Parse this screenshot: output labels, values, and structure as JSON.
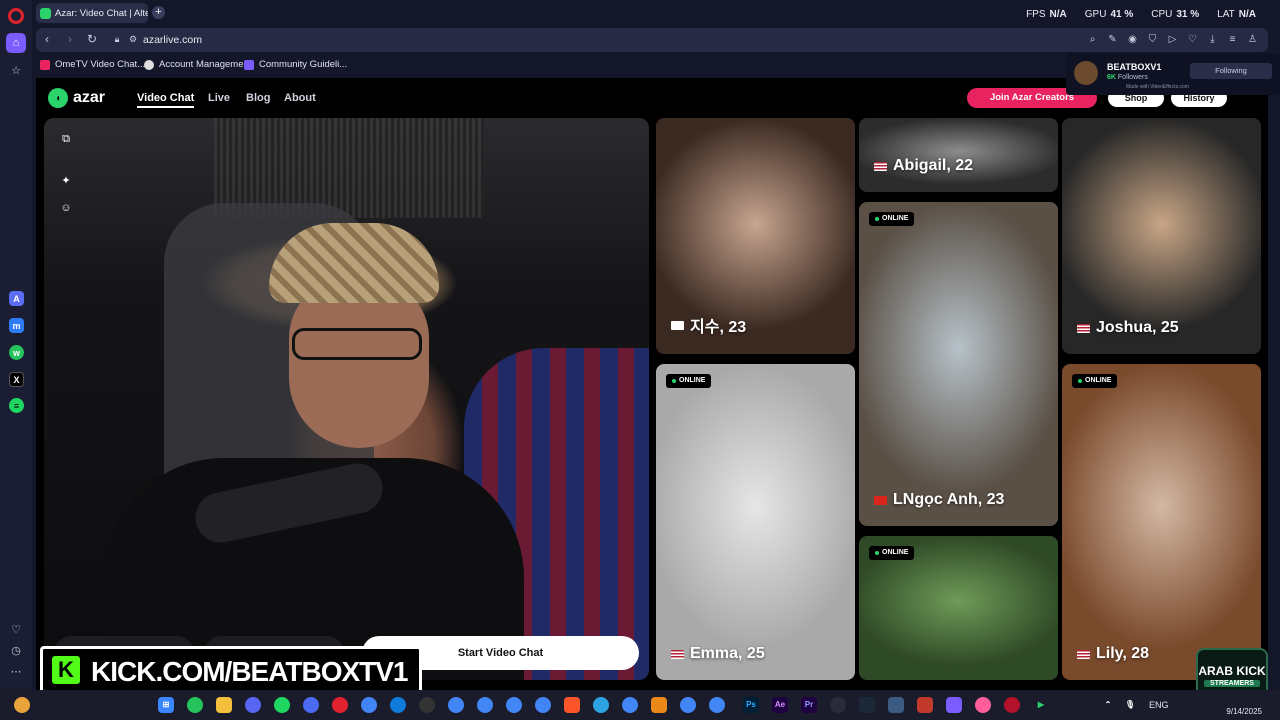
{
  "browser": {
    "tab_title": "Azar: Video Chat | Alternati",
    "url": "azarlive.com",
    "stats": [
      {
        "label": "FPS",
        "value": "N/A"
      },
      {
        "label": "GPU",
        "value": "41 %"
      },
      {
        "label": "CPU",
        "value": "31 %"
      },
      {
        "label": "LAT",
        "value": "N/A"
      }
    ],
    "bookmarks": [
      {
        "label": "OmeTV Video Chat...",
        "color": "#e8235f"
      },
      {
        "label": "Account Manageme...",
        "color": "#dddddd"
      },
      {
        "label": "Community Guideli...",
        "color": "#7a5cff"
      }
    ]
  },
  "site": {
    "logo": "azar",
    "nav": [
      {
        "label": "Video Chat",
        "active": true
      },
      {
        "label": "Live",
        "active": false
      },
      {
        "label": "Blog",
        "active": false
      },
      {
        "label": "About",
        "active": false
      }
    ],
    "creators_button": "Join Azar Creators",
    "shop_button": "Shop",
    "history_button": "History",
    "start_button": "Start Video Chat"
  },
  "profiles": [
    {
      "name": "지수, 23",
      "flag": "kr",
      "online": false,
      "colors": [
        "#c8a58f",
        "#3b2a22"
      ]
    },
    {
      "name": "Abigail, 22",
      "flag": "us",
      "online": false,
      "colors": [
        "#8d8d8d",
        "#2c2c2c"
      ]
    },
    {
      "name": "LNgọc Anh, 23",
      "flag": "vn",
      "online": true,
      "colors": [
        "#b7c2c9",
        "#5a5046"
      ]
    },
    {
      "name": "Joshua, 25",
      "flag": "us",
      "online": false,
      "colors": [
        "#c9a686",
        "#272727"
      ]
    },
    {
      "name": "Emma, 25",
      "flag": "us",
      "online": true,
      "colors": [
        "#e6e6e6",
        "#a9a9a9"
      ]
    },
    {
      "name": "",
      "flag": "",
      "online": true,
      "colors": [
        "#6f9a58",
        "#2f4a26"
      ]
    },
    {
      "name": "Lily, 28",
      "flag": "us",
      "online": true,
      "colors": [
        "#d4b8a3",
        "#7a4a2c"
      ]
    }
  ],
  "online_label": "ONLINE",
  "follow_overlay": {
    "name": "BEATBOXV1",
    "count": "6K",
    "count_label": "Followers",
    "button": "Following",
    "made_with": "Made with VideoEffects.com"
  },
  "kick_banner": "KICK.COM/BEATBOXTV1",
  "watermark": {
    "line1": "ARAB KICK",
    "line2": "STREAMERS"
  },
  "taskbar": {
    "lang": "ENG",
    "date": "9/14/2025"
  },
  "colors": {
    "accent": "#2bd46b",
    "brand_pink": "#e8235f",
    "kick_green": "#53fc18"
  }
}
